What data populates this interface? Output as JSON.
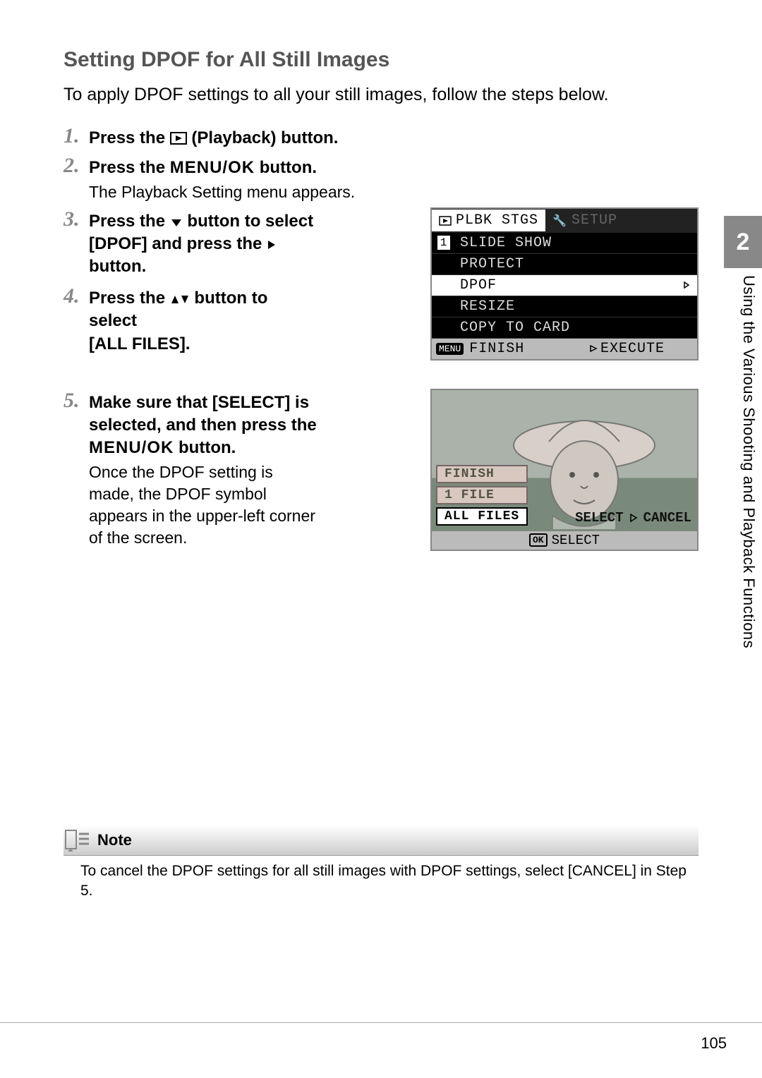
{
  "heading": "Setting DPOF for All Still Images",
  "intro": "To apply DPOF settings to all your still images, follow the steps below.",
  "steps": [
    {
      "num": "1.",
      "title_pre": "Press the ",
      "title_post": " (Playback) button."
    },
    {
      "num": "2.",
      "title_pre": "Press the ",
      "menuok": "MENU/OK",
      "title_post": " button.",
      "desc": "The Playback Setting menu appears."
    },
    {
      "num": "3.",
      "title_line1_pre": "Press the ",
      "title_line1_post": " button to select",
      "title_line2_pre": "[DPOF] and press the ",
      "title_line2_post": " button."
    },
    {
      "num": "4.",
      "title_line1_pre": "Press the ",
      "title_line1_post": " button to select",
      "title_line2": "[ALL FILES]."
    },
    {
      "num": "5.",
      "title_line1": "Make sure that [SELECT] is",
      "title_line2": "selected, and then press the",
      "menuok": "MENU/OK",
      "title_line3_post": " button.",
      "desc": "Once the DPOF setting is made, the DPOF symbol appears in the upper-left corner of the screen."
    }
  ],
  "cam1": {
    "tab_active": "PLBK STGS",
    "tab_inactive": "SETUP",
    "page": "1",
    "items": [
      "SLIDE SHOW",
      "PROTECT",
      "DPOF",
      "RESIZE",
      "COPY TO CARD"
    ],
    "selected_index": 2,
    "status_menu": "MENU",
    "status_finish": "FINISH",
    "status_execute": "EXECUTE"
  },
  "cam2": {
    "left": [
      "FINISH",
      "1 FILE",
      "ALL FILES"
    ],
    "left_selected_index": 2,
    "right_select": "SELECT",
    "right_cancel": "CANCEL",
    "bottom_ok": "OK",
    "bottom_label": "SELECT"
  },
  "sidetab": {
    "chapter": "2",
    "label": "Using the Various Shooting and Playback Functions"
  },
  "note": {
    "label": "Note",
    "body": "To cancel the DPOF settings for all still images with DPOF settings, select [CANCEL] in Step 5."
  },
  "page_number": "105"
}
